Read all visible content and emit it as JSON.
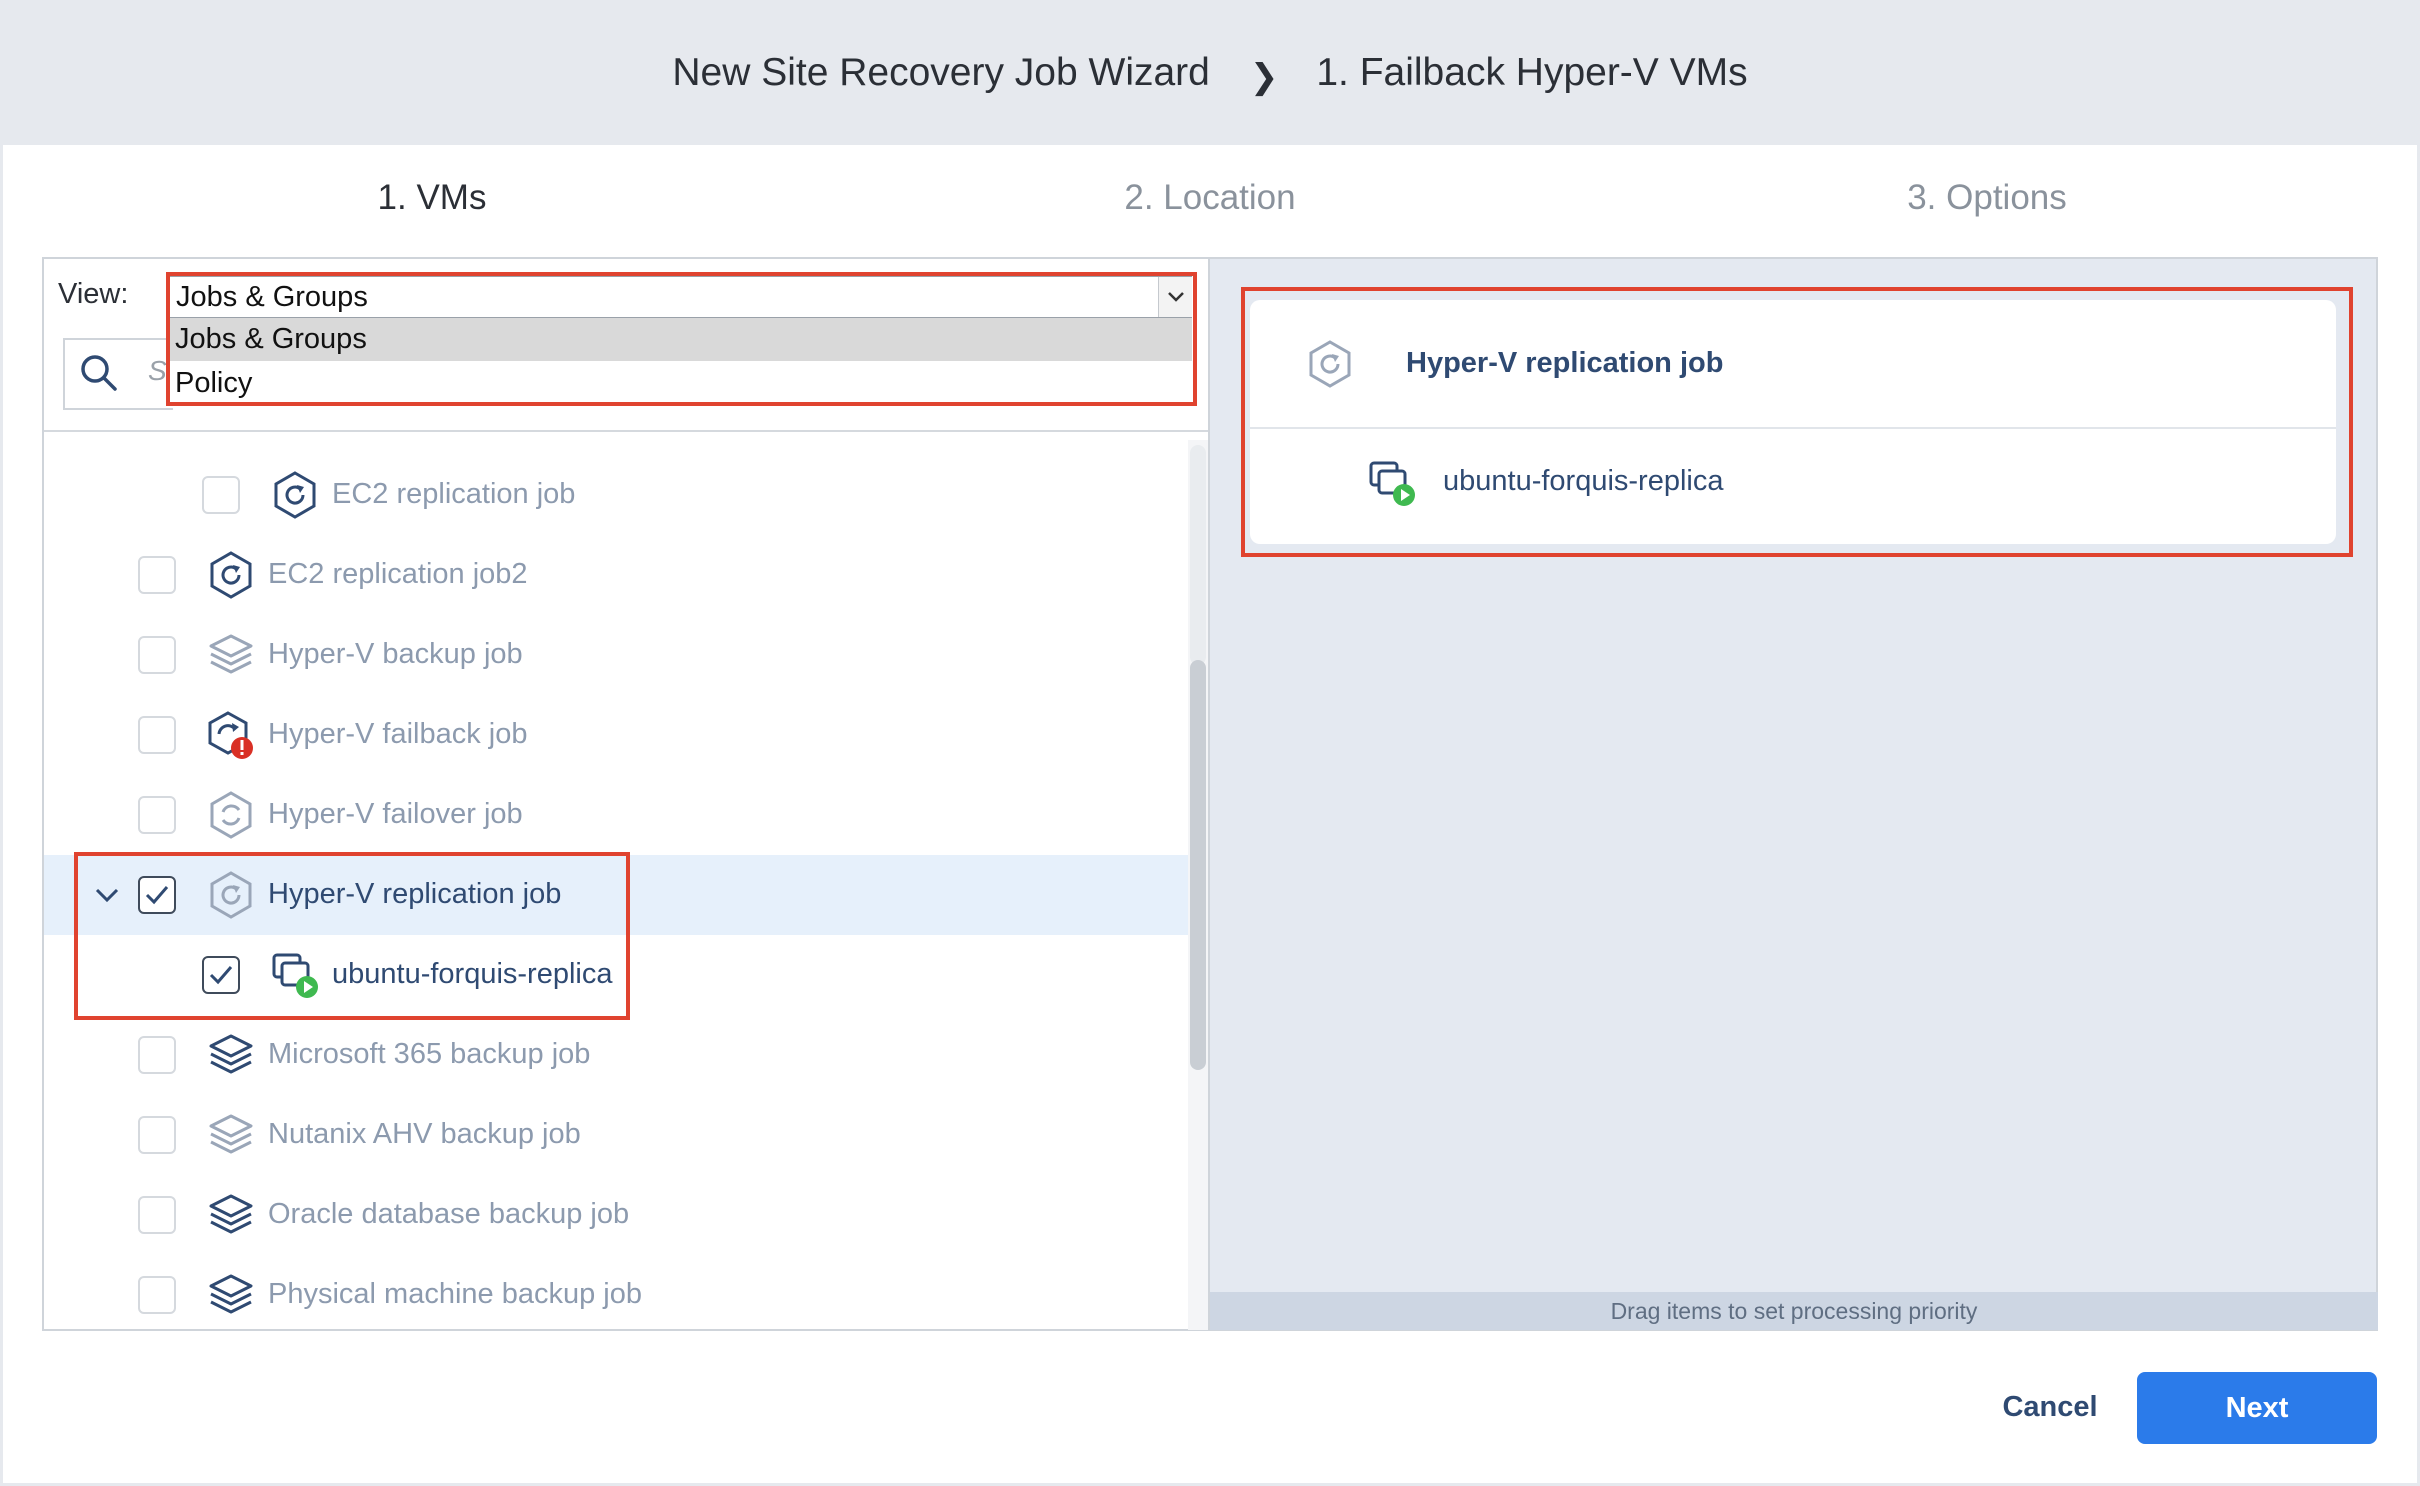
{
  "wizard": {
    "title": "New Site Recovery Job Wizard",
    "separator": "❯",
    "current_step_title": "1. Failback Hyper-V VMs"
  },
  "steps": [
    {
      "label": "1. VMs",
      "active": true
    },
    {
      "label": "2. Location",
      "active": false
    },
    {
      "label": "3. Options",
      "active": false
    }
  ],
  "view": {
    "label": "View:",
    "selected": "Jobs & Groups",
    "options": [
      "Jobs & Groups",
      "Policy"
    ]
  },
  "search": {
    "placeholder_visible": "S"
  },
  "tree": {
    "items": [
      {
        "label": "EC2 replication job",
        "icon": "replication-hexagon-icon",
        "checked": false
      },
      {
        "label": "EC2 replication job2",
        "icon": "replication-hexagon-icon",
        "checked": false
      },
      {
        "label": "Hyper-V backup job",
        "icon": "backup-layers-icon",
        "checked": false
      },
      {
        "label": "Hyper-V failback job",
        "icon": "failback-error-icon",
        "checked": false
      },
      {
        "label": "Hyper-V failover job",
        "icon": "failover-hexagon-icon",
        "checked": false
      },
      {
        "label": "Hyper-V replication job",
        "icon": "replication-hexagon-icon",
        "checked": true,
        "expanded": true
      },
      {
        "label": "ubuntu-forquis-replica",
        "icon": "vm-replica-running-icon",
        "checked": true
      },
      {
        "label": "Microsoft 365 backup job",
        "icon": "backup-layers-icon",
        "checked": false
      },
      {
        "label": "Nutanix AHV backup job",
        "icon": "backup-layers-icon",
        "checked": false
      },
      {
        "label": "Oracle database backup job",
        "icon": "backup-layers-icon",
        "checked": false
      },
      {
        "label": "Physical machine backup job",
        "icon": "backup-layers-icon",
        "checked": false
      }
    ]
  },
  "selected_panel": {
    "job_label": "Hyper-V replication job",
    "vm_label": "ubuntu-forquis-replica",
    "hint": "Drag items to set processing priority"
  },
  "footer": {
    "cancel_label": "Cancel",
    "next_label": "Next"
  },
  "colors": {
    "highlight": "#e0432f",
    "primary": "#2b7bea",
    "text_active": "#2f4a72",
    "text_muted": "#8c9aae",
    "running_green": "#3fb950",
    "error_red": "#d93025"
  }
}
